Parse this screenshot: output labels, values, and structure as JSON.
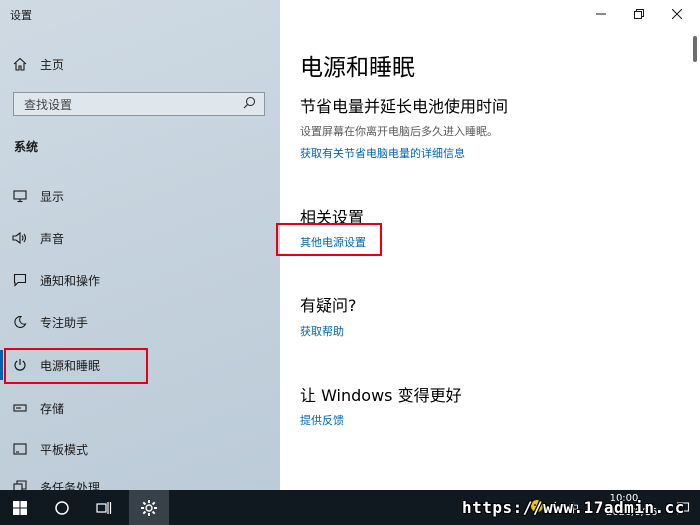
{
  "window": {
    "title": "设置"
  },
  "sidebar": {
    "home_label": "主页",
    "search_placeholder": "查找设置",
    "section_label": "系统",
    "items": [
      {
        "label": "显示",
        "icon": "monitor-icon"
      },
      {
        "label": "声音",
        "icon": "speaker-icon"
      },
      {
        "label": "通知和操作",
        "icon": "notification-icon"
      },
      {
        "label": "专注助手",
        "icon": "moon-icon"
      },
      {
        "label": "电源和睡眠",
        "icon": "power-icon",
        "active": true
      },
      {
        "label": "存储",
        "icon": "storage-icon"
      },
      {
        "label": "平板模式",
        "icon": "tablet-icon"
      },
      {
        "label": "多任务处理",
        "icon": "multitask-icon"
      }
    ]
  },
  "main": {
    "title": "电源和睡眠",
    "save_section": {
      "heading": "节省电量并延长电池使用时间",
      "desc": "设置屏幕在你离开电脑后多久进入睡眠。",
      "link": "获取有关节省电脑电量的详细信息"
    },
    "related": {
      "heading": "相关设置",
      "link": "其他电源设置"
    },
    "question": {
      "heading": "有疑问?",
      "link": "获取帮助"
    },
    "feedback": {
      "heading": "让 Windows 变得更好",
      "link": "提供反馈"
    }
  },
  "taskbar": {
    "time": "10:00",
    "date": "2020/9/16",
    "ime": "中",
    "watermark": "https://www.17admin.cc"
  },
  "colors": {
    "accent": "#0063b1",
    "link": "#0066b4",
    "highlight_box": "#e60012",
    "taskbar": "#101820"
  }
}
